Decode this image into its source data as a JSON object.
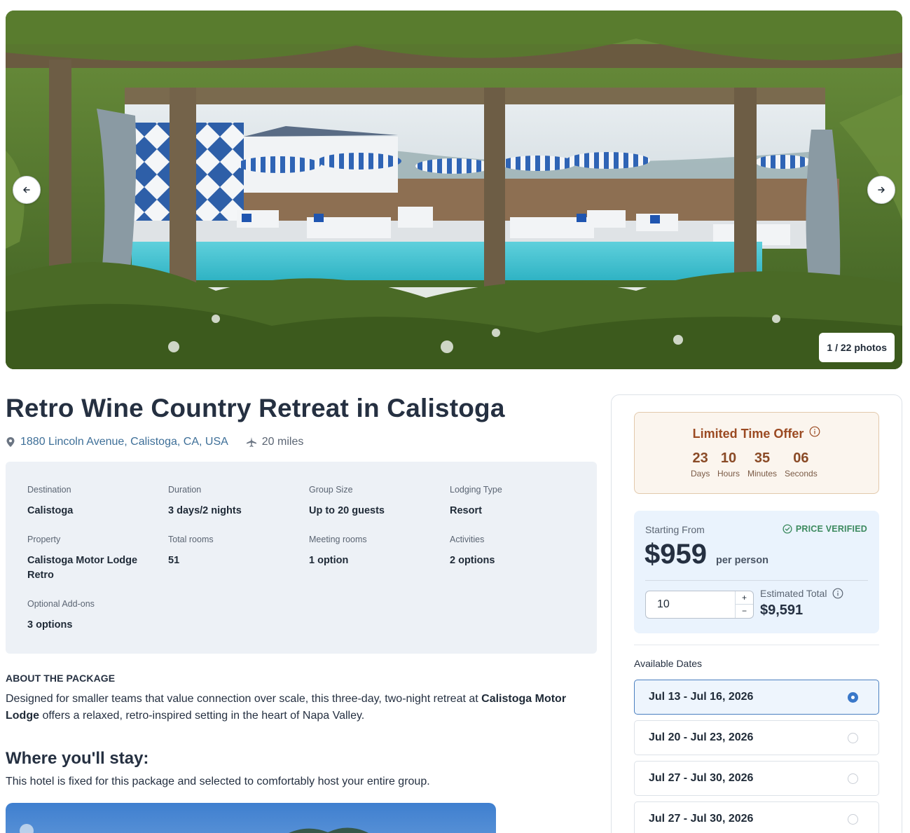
{
  "hero": {
    "photo_counter": "1 / 22 photos",
    "prev_icon": "arrow-left-icon",
    "next_icon": "arrow-right-icon"
  },
  "package": {
    "title": "Retro Wine Country Retreat in Calistoga",
    "address": "1880 Lincoln Avenue, Calistoga, CA, USA",
    "distance": "20 miles",
    "location_icon": "map-pin-icon",
    "distance_icon": "plane-icon"
  },
  "facts": [
    {
      "label": "Destination",
      "value": "Calistoga"
    },
    {
      "label": "Duration",
      "value": "3 days/2 nights"
    },
    {
      "label": "Group Size",
      "value": "Up to 20 guests"
    },
    {
      "label": "Lodging Type",
      "value": "Resort"
    },
    {
      "label": "Property",
      "value": "Calistoga Motor Lodge Retro"
    },
    {
      "label": "Total rooms",
      "value": "51"
    },
    {
      "label": "Meeting rooms",
      "value": "1 option"
    },
    {
      "label": "Activities",
      "value": "2 options"
    },
    {
      "label": "Optional Add-ons",
      "value": "3 options"
    }
  ],
  "about": {
    "heading": "ABOUT THE PACKAGE",
    "text_1": "Designed for smaller teams that value connection over scale, this three-day, two-night retreat at ",
    "text_bold": "Calistoga Motor Lodge",
    "text_2": " offers a relaxed, retro-inspired setting in the heart of Napa Valley."
  },
  "stay": {
    "heading": "Where you'll stay:",
    "subtitle": "This hotel is fixed for this package and selected to comfortably host your entire group."
  },
  "offer": {
    "title": "Limited Time Offer",
    "timer": [
      {
        "value": "23",
        "unit": "Days"
      },
      {
        "value": "10",
        "unit": "Hours"
      },
      {
        "value": "35",
        "unit": "Minutes"
      },
      {
        "value": "06",
        "unit": "Seconds"
      }
    ]
  },
  "pricing": {
    "starting_label": "Starting From",
    "verified_label": "PRICE VERIFIED",
    "price": "$959",
    "per": "per person",
    "quantity": "10",
    "estimated_label": "Estimated Total",
    "estimated_value": "$9,591",
    "increment": "+",
    "decrement": "−"
  },
  "dates": {
    "label": "Available Dates",
    "options": [
      {
        "text": "Jul 13 - Jul 16, 2026",
        "selected": true
      },
      {
        "text": "Jul 20 - Jul 23, 2026",
        "selected": false
      },
      {
        "text": "Jul 27 - Jul 30, 2026",
        "selected": false
      },
      {
        "text": "Jul 27 - Jul 30, 2026",
        "selected": false
      }
    ]
  },
  "colors": {
    "accent_blue": "#3a78c9",
    "offer_brown": "#9b4a22",
    "verified_green": "#3c8a5f",
    "facts_bg": "#edf1f6",
    "price_bg": "#eaf3fd"
  }
}
